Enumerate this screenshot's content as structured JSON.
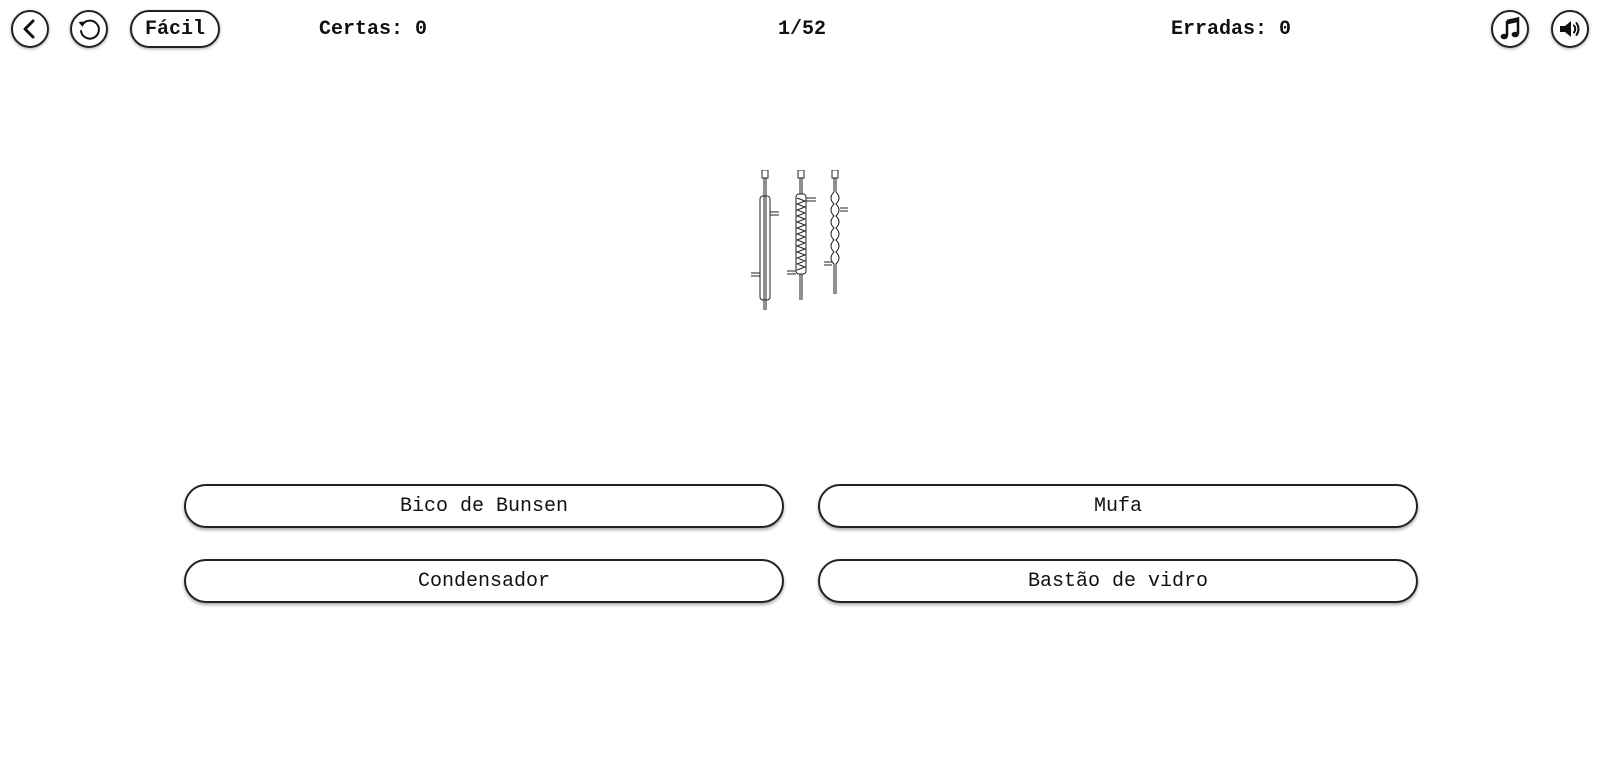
{
  "header": {
    "back_icon": "chevron-left-icon",
    "restart_icon": "restart-icon",
    "difficulty_label": "Fácil",
    "correct_text": "Certas: 0",
    "progress_text": "1/52",
    "wrong_text": "Erradas: 0",
    "music_icon": "music-note-icon",
    "sound_icon": "speaker-icon"
  },
  "question": {
    "image_icon": "condenser-glassware-illustration"
  },
  "answers": [
    {
      "label": "Bico de Bunsen"
    },
    {
      "label": "Mufa"
    },
    {
      "label": "Condensador"
    },
    {
      "label": "Bastão de vidro"
    }
  ]
}
